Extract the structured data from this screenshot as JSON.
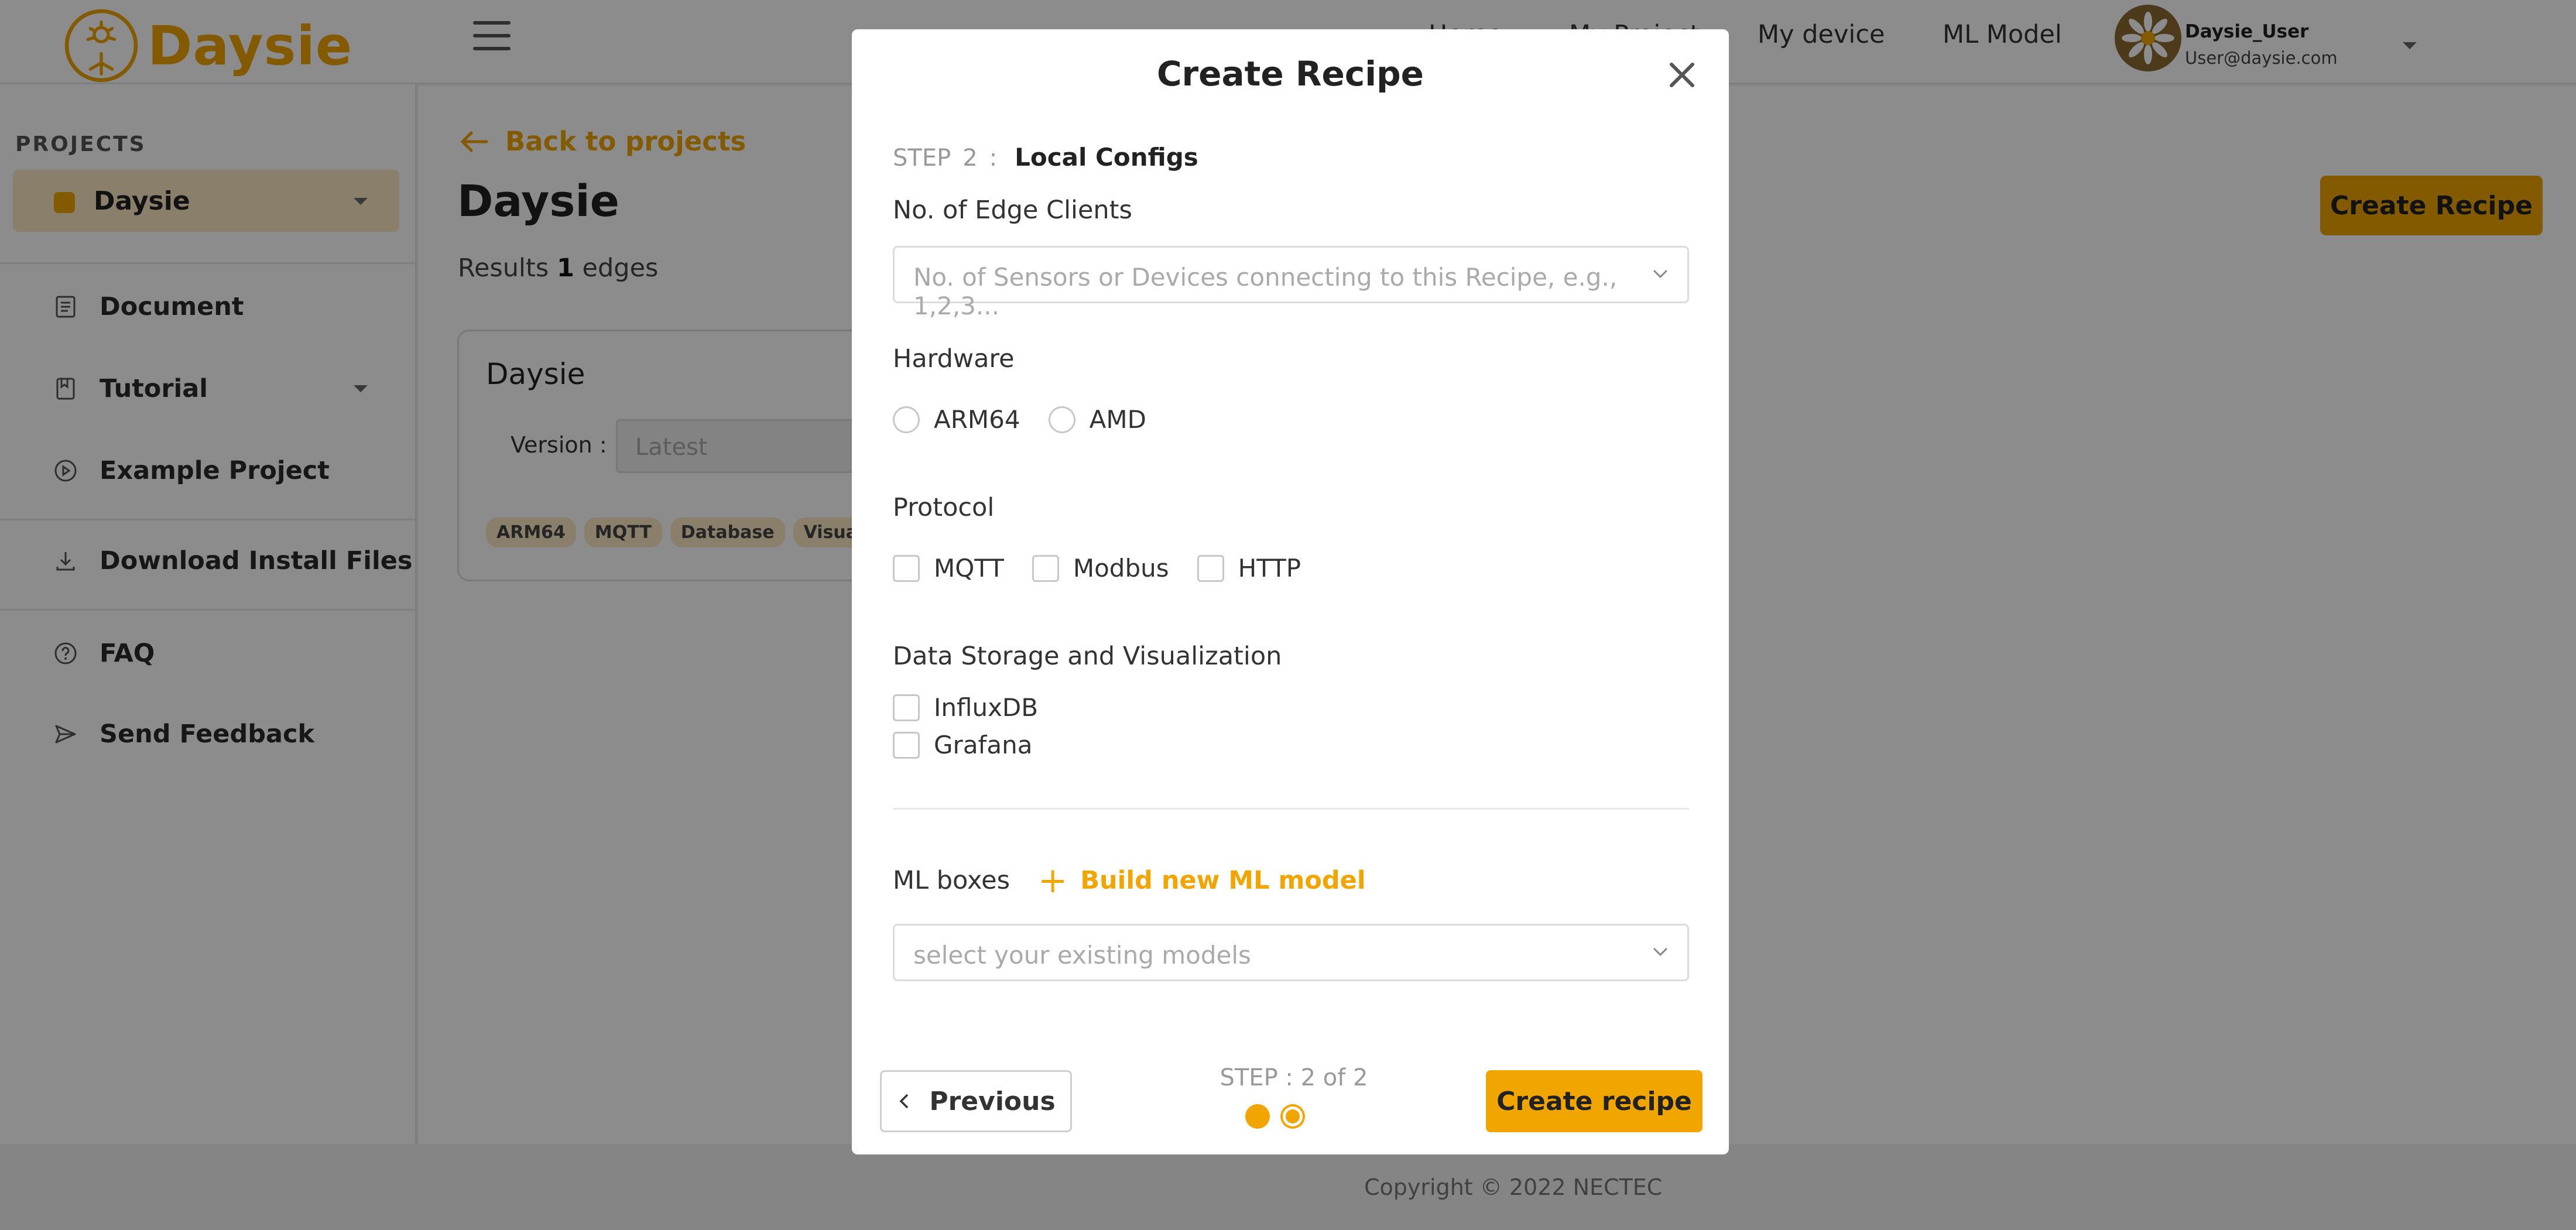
{
  "brand": {
    "name": "Daysie",
    "color": "#f0a500"
  },
  "header": {
    "nav": [
      "Home",
      "My Project",
      "My device",
      "ML Model"
    ],
    "user": {
      "name": "Daysie_User",
      "email": "User@daysie.com"
    }
  },
  "sidebar": {
    "section_label": "PROJECTS",
    "project_selected": "Daysie",
    "items": [
      {
        "label": "Document",
        "icon": "document-icon"
      },
      {
        "label": "Tutorial",
        "icon": "book-icon"
      },
      {
        "label": "Example Project",
        "icon": "play-circle-icon"
      },
      {
        "label": "Download Install Files",
        "icon": "download-icon"
      },
      {
        "label": "FAQ",
        "icon": "help-circle-icon"
      },
      {
        "label": "Send Feedback",
        "icon": "send-icon"
      }
    ]
  },
  "main": {
    "back_label": "Back to projects",
    "title": "Daysie",
    "results_prefix": "Results",
    "results_count": "1",
    "results_suffix": "edges",
    "create_button": "Create Recipe",
    "card": {
      "title": "Daysie",
      "version_label": "Version :",
      "version_placeholder": "Latest",
      "tags": [
        "ARM64",
        "MQTT",
        "Database",
        "Visualization"
      ]
    }
  },
  "footer": {
    "copyright": "Copyright © 2022 NECTEC"
  },
  "modal": {
    "title": "Create Recipe",
    "step_word": "STEP",
    "step_num": "2",
    "step_sep": ":",
    "step_name": "Local Configs",
    "edge_clients": {
      "label": "No. of Edge Clients",
      "placeholder": "No. of Sensors or Devices connecting to this Recipe, e.g., 1,2,3..."
    },
    "hardware": {
      "label": "Hardware",
      "options": [
        "ARM64",
        "AMD"
      ]
    },
    "protocol": {
      "label": "Protocol",
      "options": [
        "MQTT",
        "Modbus",
        "HTTP"
      ]
    },
    "storage": {
      "label": "Data Storage and Visualization",
      "options": [
        "InfluxDB",
        "Grafana"
      ]
    },
    "ml": {
      "label": "ML boxes",
      "build_link": "Build new ML model",
      "select_placeholder": "select your existing models"
    },
    "footer": {
      "previous": "Previous",
      "step_text": "STEP :  2  of 2",
      "create": "Create recipe"
    }
  }
}
